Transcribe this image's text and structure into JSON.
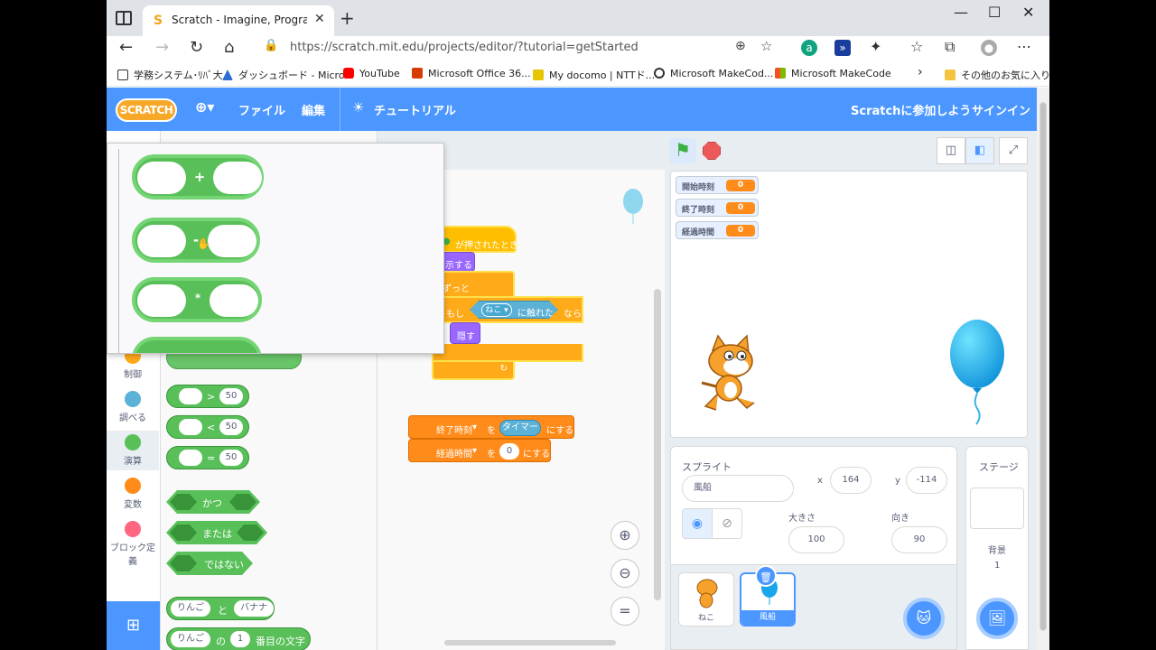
{
  "browser": {
    "tab_title": "Scratch - Imagine, Program, Share",
    "url": "https://scratch.mit.edu/projects/editor/?tutorial=getStarted",
    "bookmarks": [
      "学務システム･ﾘﾊﾞ大",
      "ダッシュボード - Micro...",
      "YouTube",
      "Microsoft Office 36...",
      "My docomo | NTTド...",
      "Microsoft MakeCod...",
      "Microsoft MakeCode",
      "その他のお気に入り"
    ]
  },
  "menubar": {
    "logo": "SCRATCH",
    "file": "ファイル",
    "edit": "編集",
    "tutorial": "チュートリアル",
    "join": "Scratchに参加しよう",
    "signin": "サインイン"
  },
  "categories": [
    {
      "label": "制御",
      "color": "#ffab19"
    },
    {
      "label": "調べる",
      "color": "#5cb1d6"
    },
    {
      "label": "演算",
      "color": "#59c059"
    },
    {
      "label": "変数",
      "color": "#ff8c1a"
    },
    {
      "label": "ブロック定義",
      "color": "#ff6680"
    }
  ],
  "palette": {
    "gt": ">",
    "lt": "<",
    "eq": "=",
    "num": "50",
    "and": "かつ",
    "or": "または",
    "not": "ではない",
    "join_a": "りんご",
    "join_mid": "と",
    "join_b": "バナナ",
    "letter_a": "りんご",
    "letter_mid": "の",
    "letter_n": "1",
    "letter_end": "番目の文字"
  },
  "popup": {
    "ops": [
      "+",
      "-",
      "*"
    ]
  },
  "script": {
    "when_flag": "が押されたとき",
    "show": "示する",
    "forever": "ずっと",
    "if": "もし",
    "sprite": "ねこ",
    "touching": "に触れた",
    "then": "なら",
    "hide": "隠す",
    "set1_var": "終了時刻",
    "to": "を",
    "timer": "タイマー",
    "set_end": "にする",
    "set2_var": "経過時間",
    "zero": "0"
  },
  "monitors": [
    {
      "label": "開始時刻",
      "value": "0"
    },
    {
      "label": "終了時刻",
      "value": "0"
    },
    {
      "label": "経過時間",
      "value": "0"
    }
  ],
  "sprite_info": {
    "header": "スプライト",
    "name": "風船",
    "x_label": "x",
    "x": "164",
    "y_label": "y",
    "y": "-114",
    "size_label": "大きさ",
    "size": "100",
    "dir_label": "向き",
    "dir": "90"
  },
  "sprites": [
    "ねこ",
    "風船"
  ],
  "stage_pane": {
    "title": "ステージ",
    "backdrop_label": "背景",
    "backdrop_count": "1"
  },
  "colors": {
    "scratch_blue": "#4c97ff",
    "operators": "#59c059",
    "events": "#ffbf00",
    "variables": "#ff8c1a"
  }
}
